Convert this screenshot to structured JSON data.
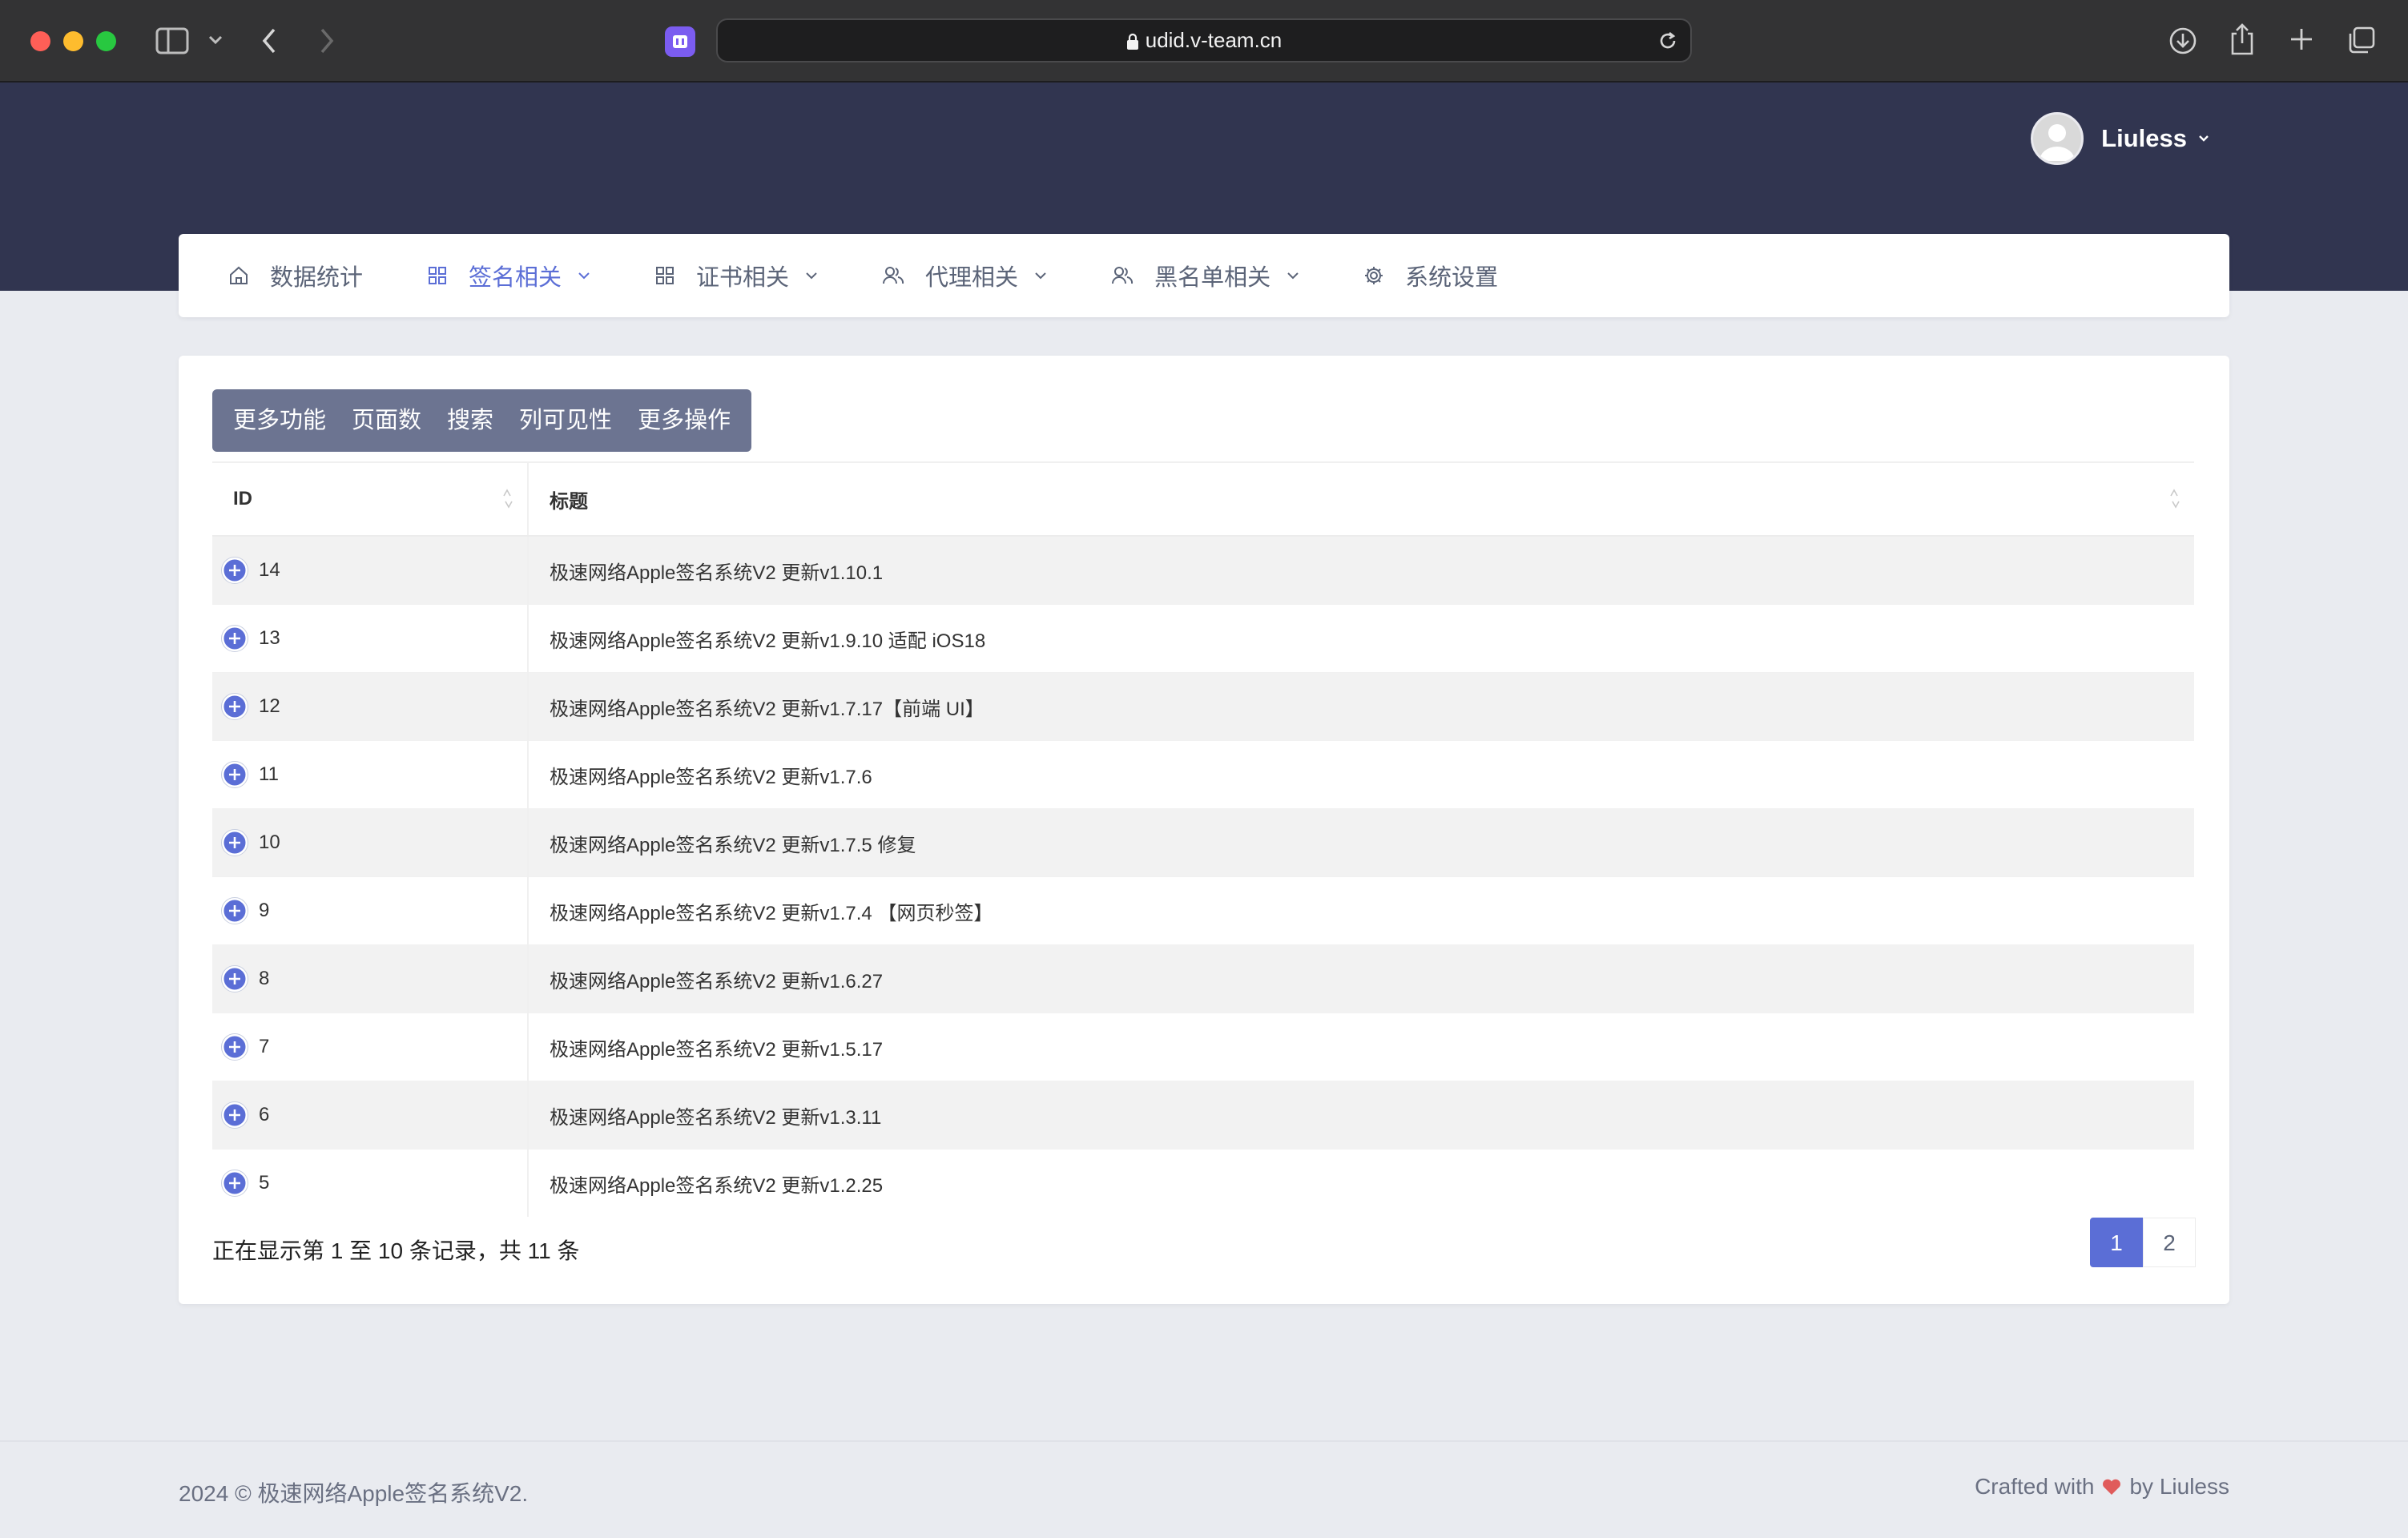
{
  "browser": {
    "url": "udid.v-team.cn"
  },
  "header": {
    "user_name": "Liuless"
  },
  "nav": {
    "items": [
      {
        "label": "数据统计"
      },
      {
        "label": "签名相关"
      },
      {
        "label": "证书相关"
      },
      {
        "label": "代理相关"
      },
      {
        "label": "黑名单相关"
      },
      {
        "label": "系统设置"
      }
    ],
    "active_color": "#5b6ed6"
  },
  "toolbar": {
    "buttons": [
      "更多功能",
      "页面数",
      "搜索",
      "列可见性",
      "更多操作"
    ]
  },
  "table": {
    "columns": [
      "ID",
      "标题"
    ],
    "rows": [
      {
        "id": "14",
        "title": "极速网络Apple签名系统V2 更新v1.10.1"
      },
      {
        "id": "13",
        "title": "极速网络Apple签名系统V2 更新v1.9.10 适配 iOS18"
      },
      {
        "id": "12",
        "title": "极速网络Apple签名系统V2 更新v1.7.17【前端 UI】"
      },
      {
        "id": "11",
        "title": "极速网络Apple签名系统V2 更新v1.7.6"
      },
      {
        "id": "10",
        "title": "极速网络Apple签名系统V2 更新v1.7.5 修复"
      },
      {
        "id": "9",
        "title": "极速网络Apple签名系统V2 更新v1.7.4 【网页秒签】"
      },
      {
        "id": "8",
        "title": "极速网络Apple签名系统V2 更新v1.6.27"
      },
      {
        "id": "7",
        "title": "极速网络Apple签名系统V2 更新v1.5.17"
      },
      {
        "id": "6",
        "title": "极速网络Apple签名系统V2 更新v1.3.11"
      },
      {
        "id": "5",
        "title": "极速网络Apple签名系统V2 更新v1.2.25"
      }
    ]
  },
  "pagination": {
    "info": "正在显示第 1 至 10 条记录，共 11 条",
    "pages": [
      "1",
      "2"
    ],
    "current": "1"
  },
  "footer": {
    "copyright": "2024 © 极速网络Apple签名系统V2.",
    "crafted_prefix": "Crafted with",
    "crafted_suffix": "by Liuless"
  },
  "colors": {
    "header_bg": "#313550",
    "accent": "#5b6ed6",
    "heart": "#e05b5b"
  },
  "icons": {
    "nav": [
      "home-icon",
      "grid-icon",
      "grid-icon",
      "users-icon",
      "users-icon",
      "gear-icon"
    ],
    "row": "plus-circle-icon"
  }
}
